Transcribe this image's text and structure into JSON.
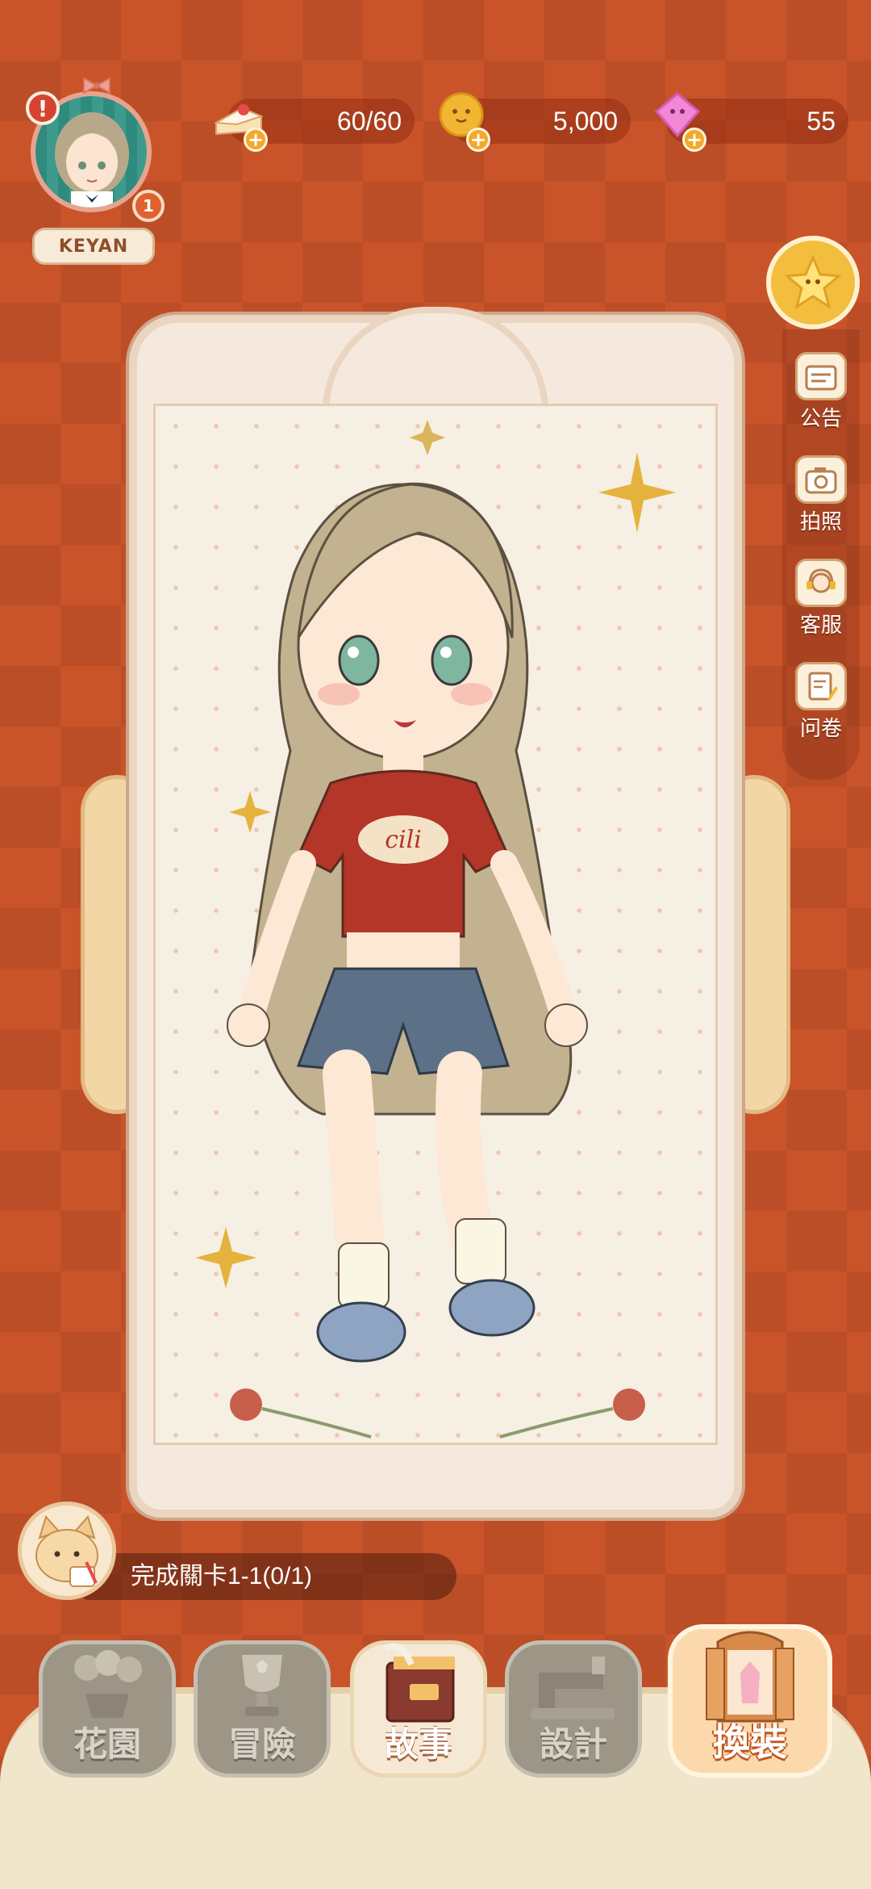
{
  "profile": {
    "name": "KEYAN",
    "level": "1",
    "alert": "!"
  },
  "resources": [
    {
      "name": "stamina",
      "value": "60/60",
      "icon": "cake-icon"
    },
    {
      "name": "coins",
      "value": "5,000",
      "icon": "coin-icon"
    },
    {
      "name": "gems",
      "value": "55",
      "icon": "gem-icon"
    }
  ],
  "side_menu": [
    {
      "label": "公告",
      "icon": "notice-board-icon"
    },
    {
      "label": "拍照",
      "icon": "camera-icon"
    },
    {
      "label": "客服",
      "icon": "support-agent-icon"
    },
    {
      "label": "问卷",
      "icon": "survey-icon"
    }
  ],
  "quest": {
    "text": "完成關卡1-1(0/1)"
  },
  "bottom_nav": [
    {
      "label": "花園",
      "state": "locked"
    },
    {
      "label": "冒險",
      "state": "locked"
    },
    {
      "label": "故事",
      "state": "available"
    },
    {
      "label": "設計",
      "state": "locked"
    },
    {
      "label": "換裝",
      "state": "active"
    }
  ],
  "colors": {
    "background": "#c9542a",
    "accent": "#f3be3e",
    "frame": "#f6efe3"
  }
}
